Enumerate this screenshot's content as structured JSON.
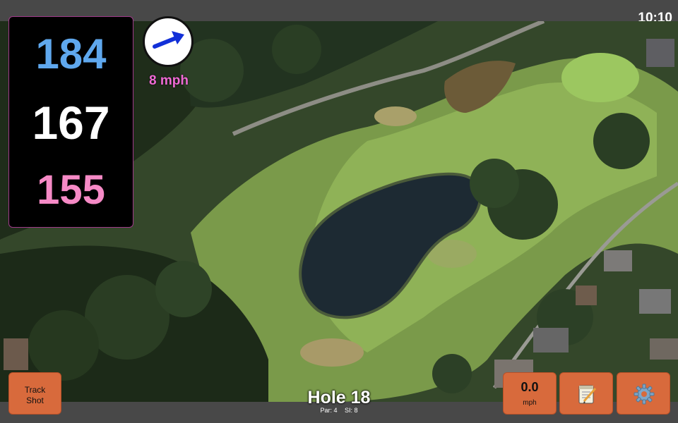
{
  "status_bar": {
    "time": "10:10"
  },
  "distances": {
    "back": "184",
    "center": "167",
    "front": "155"
  },
  "wind": {
    "speed_label": "8 mph",
    "direction_icon": "arrow-icon"
  },
  "hole": {
    "title": "Hole 18",
    "par_label": "Par: 4",
    "si_label": "SI: 8"
  },
  "buttons": {
    "track_shot_line1": "Track",
    "track_shot_line2": "Shot",
    "speed_value": "0.0",
    "speed_unit": "mph",
    "notes_icon": "notepad-icon",
    "settings_icon": "gear-icon"
  },
  "colors": {
    "back_distance": "#5fa8ee",
    "center_distance": "#ffffff",
    "front_distance": "#f68ac6",
    "wind_text": "#ef6ad4",
    "button": "#d86a3c"
  }
}
